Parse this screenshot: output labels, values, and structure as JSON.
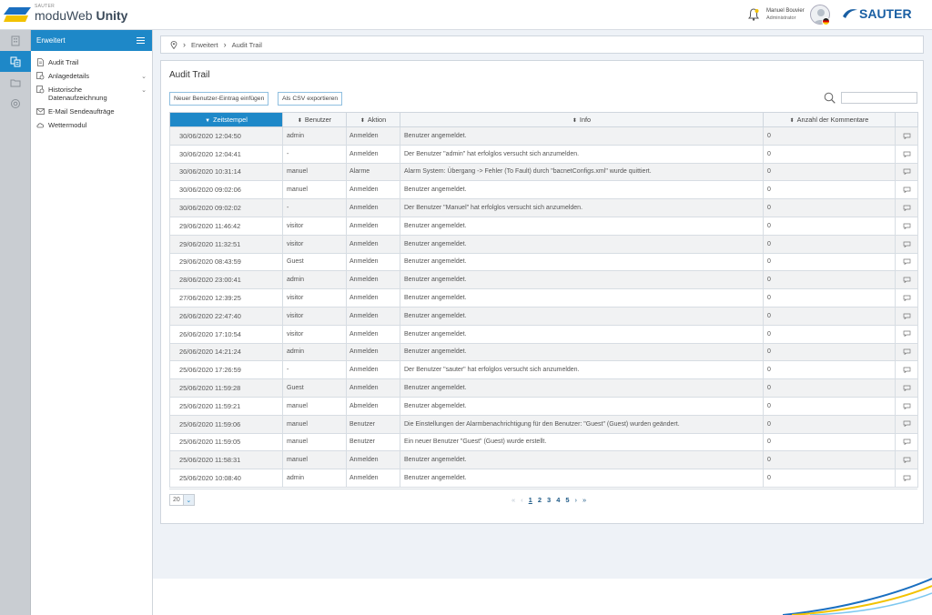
{
  "header": {
    "brand_small": "SAUTER",
    "brand_prefix": "moduWeb",
    "brand_bold": "Unity",
    "user_name": "Manuel Bouvier",
    "user_role": "Administrator",
    "company": "SAUTER"
  },
  "sidebar": {
    "title": "Erweitert",
    "items": [
      {
        "label": "Audit Trail"
      },
      {
        "label": "Anlagedetails"
      },
      {
        "label": "Historische Datenaufzeichnung"
      },
      {
        "label": "E-Mail Sendeaufträge"
      },
      {
        "label": "Wettermodul"
      }
    ]
  },
  "breadcrumb": {
    "level1": "Erweitert",
    "level2": "Audit Trail"
  },
  "panel": {
    "title": "Audit Trail",
    "btn_new": "Neuer Benutzer-Eintrag einfügen",
    "btn_csv": "Als CSV exportieren",
    "search_placeholder": ""
  },
  "table": {
    "columns": [
      "Zeitstempel",
      "Benutzer",
      "Aktion",
      "Info",
      "Anzahl der Kommentare"
    ],
    "rows": [
      [
        "30/06/2020 12:04:50",
        "admin",
        "Anmelden",
        "Benutzer angemeldet.",
        "0"
      ],
      [
        "30/06/2020 12:04:41",
        "-",
        "Anmelden",
        "Der Benutzer \"admin\" hat erfolglos versucht sich anzumelden.",
        "0"
      ],
      [
        "30/06/2020 10:31:14",
        "manuel",
        "Alarme",
        "Alarm System: Übergang -> Fehler (To Fault) durch \"bacnetConfigs.xml\" wurde quittiert.",
        "0"
      ],
      [
        "30/06/2020 09:02:06",
        "manuel",
        "Anmelden",
        "Benutzer angemeldet.",
        "0"
      ],
      [
        "30/06/2020 09:02:02",
        "-",
        "Anmelden",
        "Der Benutzer \"Manuel\" hat erfolglos versucht sich anzumelden.",
        "0"
      ],
      [
        "29/06/2020 11:46:42",
        "visitor",
        "Anmelden",
        "Benutzer angemeldet.",
        "0"
      ],
      [
        "29/06/2020 11:32:51",
        "visitor",
        "Anmelden",
        "Benutzer angemeldet.",
        "0"
      ],
      [
        "29/06/2020 08:43:59",
        "Guest",
        "Anmelden",
        "Benutzer angemeldet.",
        "0"
      ],
      [
        "28/06/2020 23:00:41",
        "admin",
        "Anmelden",
        "Benutzer angemeldet.",
        "0"
      ],
      [
        "27/06/2020 12:39:25",
        "visitor",
        "Anmelden",
        "Benutzer angemeldet.",
        "0"
      ],
      [
        "26/06/2020 22:47:40",
        "visitor",
        "Anmelden",
        "Benutzer angemeldet.",
        "0"
      ],
      [
        "26/06/2020 17:10:54",
        "visitor",
        "Anmelden",
        "Benutzer angemeldet.",
        "0"
      ],
      [
        "26/06/2020 14:21:24",
        "admin",
        "Anmelden",
        "Benutzer angemeldet.",
        "0"
      ],
      [
        "25/06/2020 17:26:59",
        "-",
        "Anmelden",
        "Der Benutzer \"sauter\" hat erfolglos versucht sich anzumelden.",
        "0"
      ],
      [
        "25/06/2020 11:59:28",
        "Guest",
        "Anmelden",
        "Benutzer angemeldet.",
        "0"
      ],
      [
        "25/06/2020 11:59:21",
        "manuel",
        "Abmelden",
        "Benutzer abgemeldet.",
        "0"
      ],
      [
        "25/06/2020 11:59:06",
        "manuel",
        "Benutzer",
        "Die Einstellungen der Alarmbenachrichtigung für den Benutzer: \"Guest\" (Guest) wurden geändert.",
        "0"
      ],
      [
        "25/06/2020 11:59:05",
        "manuel",
        "Benutzer",
        "Ein neuer Benutzer \"Guest\" (Guest) wurde erstellt.",
        "0"
      ],
      [
        "25/06/2020 11:58:31",
        "manuel",
        "Anmelden",
        "Benutzer angemeldet.",
        "0"
      ],
      [
        "25/06/2020 10:08:40",
        "admin",
        "Anmelden",
        "Benutzer angemeldet.",
        "0"
      ]
    ]
  },
  "pager": {
    "page_size": "20",
    "first": "«",
    "prev": "‹",
    "pages": [
      "1",
      "2",
      "3",
      "4",
      "5"
    ],
    "current": "1",
    "next": "›",
    "last": "»"
  },
  "colors": {
    "accent": "#1e88c8",
    "brand": "#1a5fa3"
  }
}
